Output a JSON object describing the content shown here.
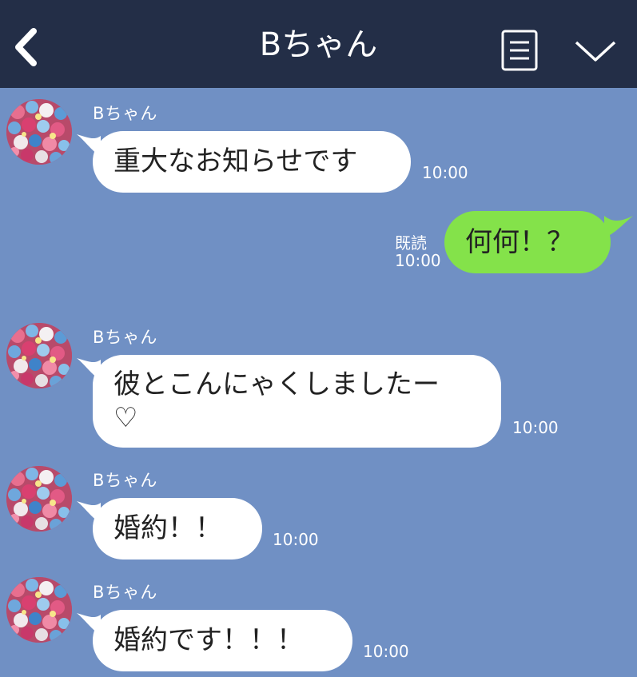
{
  "header": {
    "title": "Bちゃん",
    "back_icon": "chevron-left-icon",
    "menu_icon": "menu-document-icon",
    "dropdown_icon": "chevron-down-icon"
  },
  "colors": {
    "header_bg": "#232e47",
    "chat_bg": "#7090c4",
    "incoming_bubble": "#ffffff",
    "outgoing_bubble": "#84e24a"
  },
  "messages": [
    {
      "direction": "incoming",
      "sender": "Bちゃん",
      "text": "重大なお知らせです",
      "time": "10:00"
    },
    {
      "direction": "outgoing",
      "status": "既読",
      "text": "何何！？",
      "time": "10:00"
    },
    {
      "direction": "incoming",
      "sender": "Bちゃん",
      "text": "彼とこんにゃくしましたー\n♡",
      "time": "10:00"
    },
    {
      "direction": "incoming",
      "sender": "Bちゃん",
      "text": "婚約！！",
      "time": "10:00"
    },
    {
      "direction": "incoming",
      "sender": "Bちゃん",
      "text": "婚約です！！！",
      "time": "10:00"
    }
  ]
}
